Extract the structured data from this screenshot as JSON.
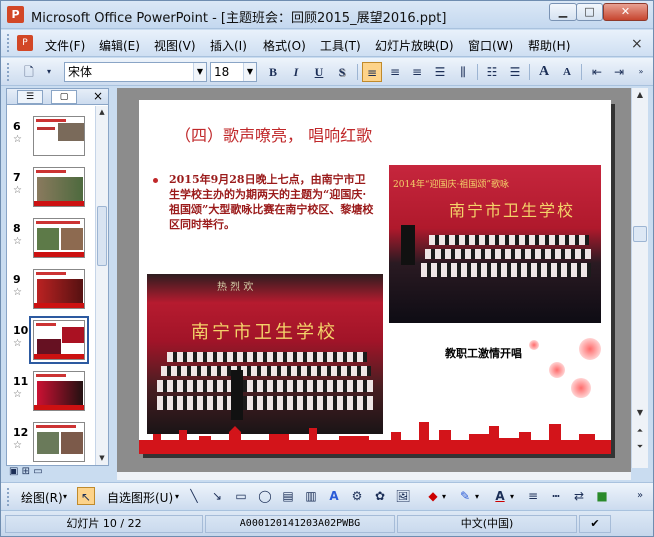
{
  "window": {
    "title": "Microsoft Office PowerPoint - [主题班会：回顾2015_展望2016.ppt]",
    "min_glyph": "▁",
    "max_glyph": "□",
    "close_glyph": "✕"
  },
  "menubar": {
    "items": [
      "文件(F)",
      "编辑(E)",
      "视图(V)",
      "插入(I)",
      "格式(O)",
      "工具(T)",
      "幻灯片放映(D)",
      "窗口(W)",
      "帮助(H)"
    ],
    "close_glyph": "×"
  },
  "toolbar": {
    "font_name": "宋体",
    "font_size": "18",
    "bold": "B",
    "italic": "I",
    "underline": "U",
    "shadow": "S",
    "increase_font": "A",
    "decrease_font": "A"
  },
  "left_pane": {
    "close_glyph": "×",
    "slides": [
      {
        "number": "6"
      },
      {
        "number": "7"
      },
      {
        "number": "8"
      },
      {
        "number": "9"
      },
      {
        "number": "10",
        "selected": true
      },
      {
        "number": "11"
      },
      {
        "number": "12"
      }
    ]
  },
  "slide": {
    "title": "（四）歌声嘹亮， 唱响红歌",
    "bullet": "2015年9月28日晚上七点，由南宁市卫生学校主办的为期两天的主题为“迎国庆·祖国颂”大型歌咏比赛在南宁校区、黎塘校区同时举行。",
    "caption": "教职工激情开唱",
    "photo_a_banner": "2014年“迎国庆·祖国颂”歌咏",
    "photo_a_sign": "南宁市卫生学校",
    "photo_b_sign": "南宁市卫生学校",
    "photo_b_top": "热 烈 欢"
  },
  "drawbar": {
    "draw_label": "绘图(R)",
    "autoshape_label": "自选图形(U)"
  },
  "status": {
    "slide_counter": "幻灯片 10 / 22",
    "template": "A000120141203A02PWBG",
    "language": "中文(中国)"
  },
  "colors": {
    "accent_red": "#c0282a",
    "window_blue": "#c9dcf0"
  }
}
